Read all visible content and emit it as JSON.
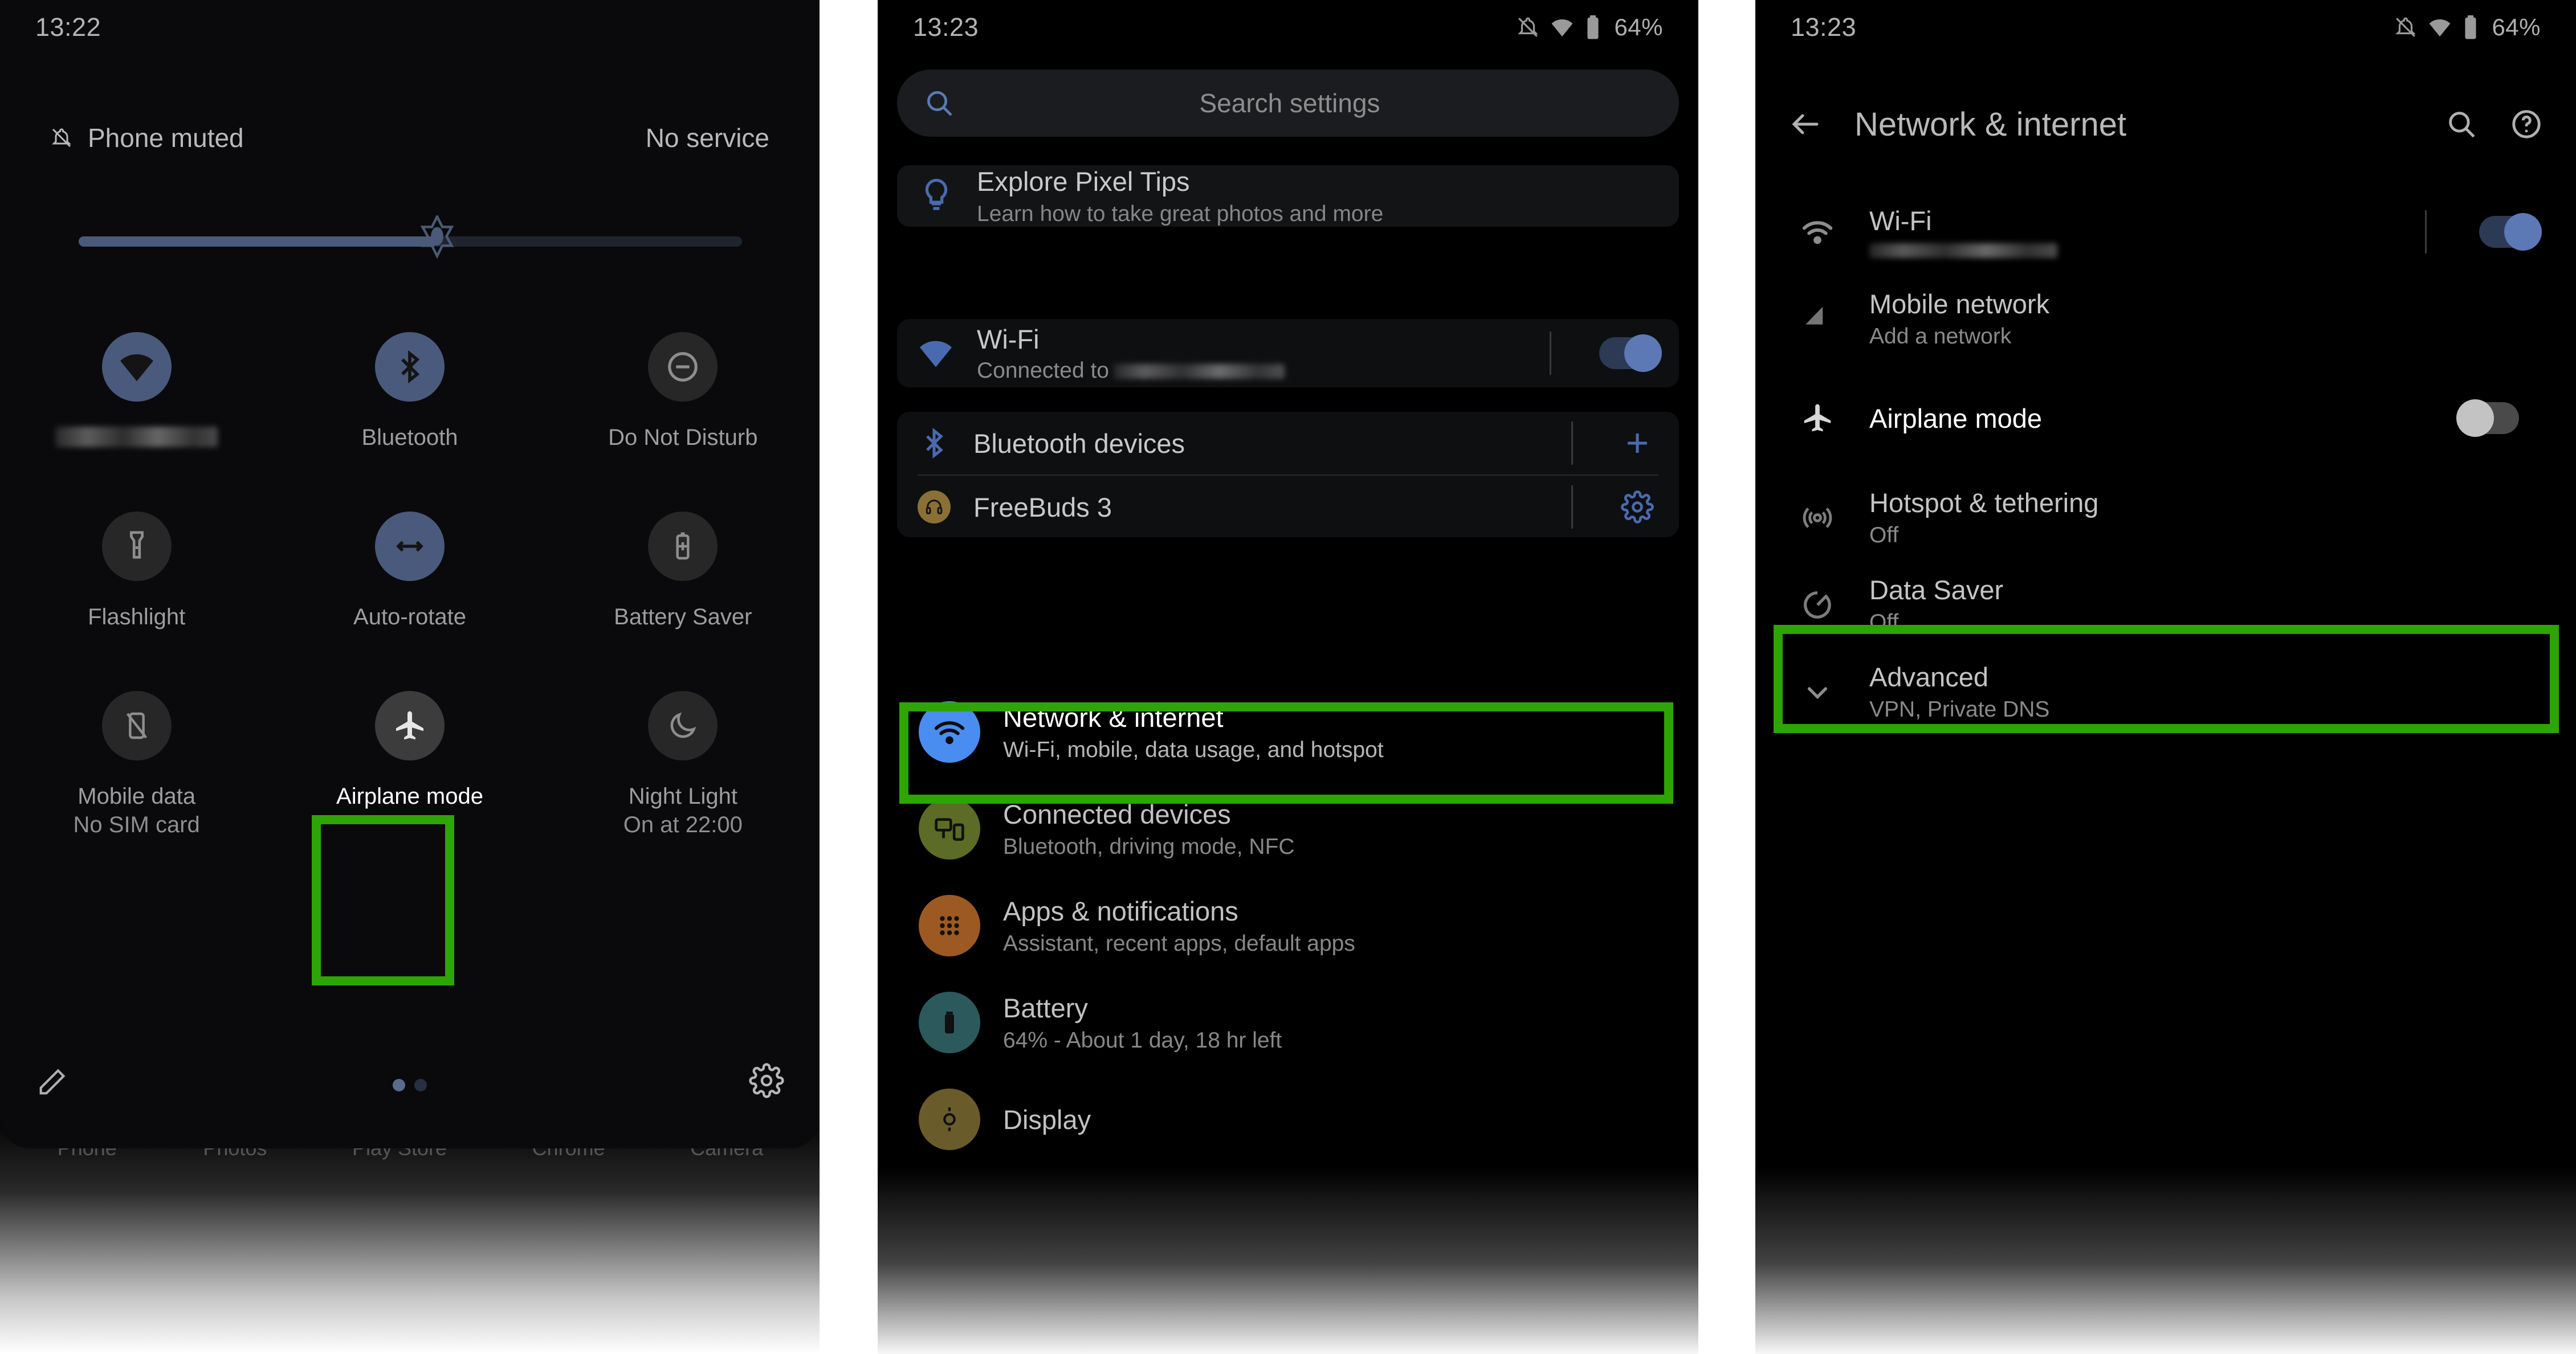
{
  "quick_settings": {
    "status_bar": {
      "clock": "13:22"
    },
    "phone_status": {
      "muted_label": "Phone muted",
      "service_label": "No service"
    },
    "volume": {
      "level_percent": 54
    },
    "tiles": [
      {
        "label": "",
        "sublabel": "",
        "icon": "wifi-icon",
        "state": "on",
        "redacted_label": true
      },
      {
        "label": "Bluetooth",
        "sublabel": "",
        "icon": "bluetooth-icon",
        "state": "on"
      },
      {
        "label": "Do Not Disturb",
        "sublabel": "",
        "icon": "do-not-disturb-icon",
        "state": "off"
      },
      {
        "label": "Flashlight",
        "sublabel": "",
        "icon": "flashlight-icon",
        "state": "off"
      },
      {
        "label": "Auto-rotate",
        "sublabel": "",
        "icon": "auto-rotate-icon",
        "state": "on"
      },
      {
        "label": "Battery Saver",
        "sublabel": "",
        "icon": "battery-saver-icon",
        "state": "off"
      },
      {
        "label": "Mobile data",
        "sublabel": "No SIM card",
        "icon": "mobile-data-off-icon",
        "state": "off"
      },
      {
        "label": "Airplane mode",
        "sublabel": "",
        "icon": "airplane-icon",
        "state": "off",
        "highlighted": true
      },
      {
        "label": "Night Light",
        "sublabel": "On at 22:00",
        "icon": "night-light-icon",
        "state": "off"
      }
    ],
    "footer": {
      "edit_icon": "pencil-icon",
      "settings_icon": "gear-icon",
      "page_count": 2,
      "page_current": 1
    },
    "dock": [
      {
        "name": "Phone",
        "icon": "phone-app-icon"
      },
      {
        "name": "Photos",
        "icon": "photos-app-icon"
      },
      {
        "name": "Play Store",
        "icon": "play-store-app-icon"
      },
      {
        "name": "Chrome",
        "icon": "chrome-app-icon"
      },
      {
        "name": "Camera",
        "icon": "camera-app-icon"
      }
    ]
  },
  "settings": {
    "status_bar": {
      "clock": "13:23",
      "battery_percent": "64%"
    },
    "search": {
      "placeholder": "Search settings",
      "icon": "search-icon"
    },
    "tips": {
      "title": "Explore Pixel Tips",
      "subtitle": "Learn how to take great photos and more",
      "icon": "lightbulb-icon"
    },
    "wifi": {
      "title": "Wi-Fi",
      "subtitle_prefix": "Connected to",
      "subtitle_redacted": true,
      "toggle": "on",
      "icon": "wifi-icon"
    },
    "bluetooth": {
      "title": "Bluetooth devices",
      "action_icon": "plus-icon",
      "icon": "bluetooth-icon"
    },
    "freebuds": {
      "title": "FreeBuds 3",
      "action_icon": "gear-icon",
      "icon": "headphones-icon"
    },
    "items": [
      {
        "title": "Network & internet",
        "subtitle": "Wi-Fi, mobile, data usage, and hotspot",
        "icon": "wifi-icon",
        "icon_color": "#4a8df0",
        "highlighted": true
      },
      {
        "title": "Connected devices",
        "subtitle": "Bluetooth, driving mode, NFC",
        "icon": "devices-icon",
        "icon_color": "#5c6b25"
      },
      {
        "title": "Apps & notifications",
        "subtitle": "Assistant, recent apps, default apps",
        "icon": "apps-grid-icon",
        "icon_color": "#9c5a22"
      },
      {
        "title": "Battery",
        "subtitle": "64% - About 1 day, 18 hr left",
        "icon": "battery-icon",
        "icon_color": "#2c5a5c"
      },
      {
        "title": "Display",
        "subtitle": "",
        "icon": "display-icon",
        "icon_color": "#6a5b2a"
      }
    ]
  },
  "network": {
    "status_bar": {
      "clock": "13:23",
      "battery_percent": "64%"
    },
    "nav": {
      "back_icon": "arrow-back-icon",
      "title": "Network & internet",
      "search_icon": "search-icon",
      "help_icon": "help-circle-icon"
    },
    "items": [
      {
        "title": "Wi-Fi",
        "subtitle": "",
        "subtitle_redacted": true,
        "icon": "wifi-icon",
        "control": "toggle",
        "toggle": "on"
      },
      {
        "title": "Mobile network",
        "subtitle": "Add a network",
        "icon": "signal-bars-icon",
        "control": "none"
      },
      {
        "title": "Airplane mode",
        "subtitle": "",
        "icon": "airplane-icon",
        "control": "toggle",
        "toggle": "off",
        "highlighted": true
      },
      {
        "title": "Hotspot & tethering",
        "subtitle": "Off",
        "icon": "hotspot-icon",
        "control": "none"
      },
      {
        "title": "Data Saver",
        "subtitle": "Off",
        "icon": "data-saver-icon",
        "control": "none"
      },
      {
        "title": "Advanced",
        "subtitle": "VPN, Private DNS",
        "icon": "chevron-down-icon",
        "control": "none"
      }
    ]
  },
  "annotation": {
    "highlight_color": "#2fa406"
  }
}
